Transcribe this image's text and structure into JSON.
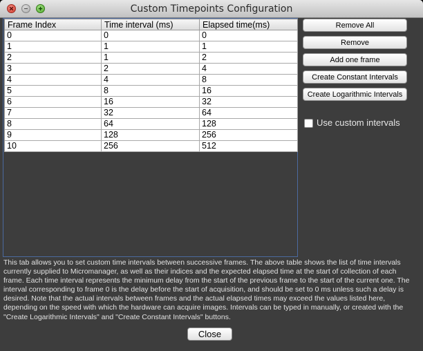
{
  "window": {
    "title": "Custom Timepoints Configuration"
  },
  "table": {
    "columns": [
      "Frame Index",
      "Time interval (ms)",
      "Elapsed time(ms)"
    ],
    "rows": [
      [
        "0",
        "0",
        "0"
      ],
      [
        "1",
        "1",
        "1"
      ],
      [
        "2",
        "1",
        "2"
      ],
      [
        "3",
        "2",
        "4"
      ],
      [
        "4",
        "4",
        "8"
      ],
      [
        "5",
        "8",
        "16"
      ],
      [
        "6",
        "16",
        "32"
      ],
      [
        "7",
        "32",
        "64"
      ],
      [
        "8",
        "64",
        "128"
      ],
      [
        "9",
        "128",
        "256"
      ],
      [
        "10",
        "256",
        "512"
      ]
    ]
  },
  "buttons": {
    "remove_all": "Remove All",
    "remove": "Remove",
    "add_one_frame": "Add one frame",
    "create_constant": "Create Constant Intervals",
    "create_logarithmic": "Create Logarithmic Intervals",
    "close": "Close"
  },
  "options": {
    "use_custom_intervals": "Use custom intervals"
  },
  "description": "This tab allows you to set custom time intervals between successive frames. The above table shows the list of time intervals currently supplied to Micromanager, as well as their indices and the expected elapsed time at the start of collection of each frame. Each time interval represents the minimum delay from the start of the previous frame to the start of the current one. The interval corresponding to frame 0 is the delay before the start of acquisition, and should be set to 0 ms unless such a delay is desired. Note that the actual intervals between frames and the actual elapsed times may exceed the values listed here, depending on the speed with which the hardware can acquire images. Intervals can be typed in manually, or created with the \"Create Logarithmic Intervals\" and \"Create Constant Intervals\" buttons."
}
